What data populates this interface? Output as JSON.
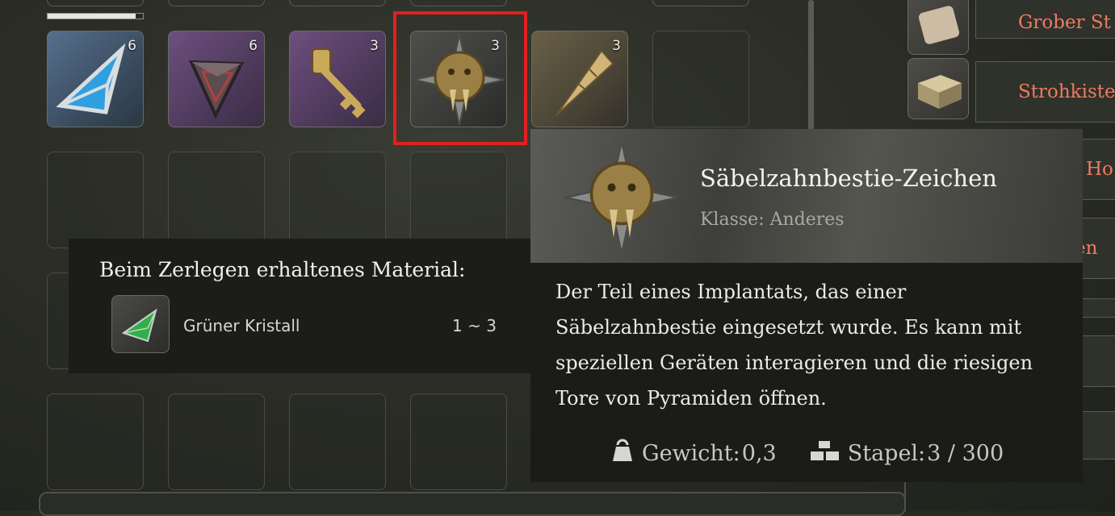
{
  "inventory": {
    "progress": 0.92,
    "slots": [
      {
        "name": "blue-pyramid-item",
        "count": "6",
        "style": "cyan"
      },
      {
        "name": "dark-pyramid-item",
        "count": "6",
        "style": "purple"
      },
      {
        "name": "golden-key-item",
        "count": "3",
        "style": "purple"
      },
      {
        "name": "sabertooth-sign-item",
        "count": "3",
        "style": "grey"
      },
      {
        "name": "golden-fang-item",
        "count": "3",
        "style": "gold"
      }
    ]
  },
  "right_list": {
    "items": [
      {
        "label": "Grober St"
      },
      {
        "label": "Strohkiste"
      },
      {
        "label": "Ho"
      },
      {
        "label": "en"
      }
    ]
  },
  "decompose": {
    "title": "Beim Zerlegen erhaltenes Material:",
    "material_name": "Grüner Kristall",
    "material_range": "1 ~ 3"
  },
  "tooltip": {
    "name": "Säbelzahnbestie-Zeichen",
    "class": "Klasse: Anderes",
    "description": "Der Teil eines Implantats, das einer Säbelzahnbestie eingesetzt wurde. Es kann mit speziellen Geräten interagieren und die riesigen Tore von Pyramiden öffnen.",
    "weight_label": "Gewicht:",
    "weight_value": "0,3",
    "stack_label": "Stapel:",
    "stack_value": "3 / 300"
  }
}
